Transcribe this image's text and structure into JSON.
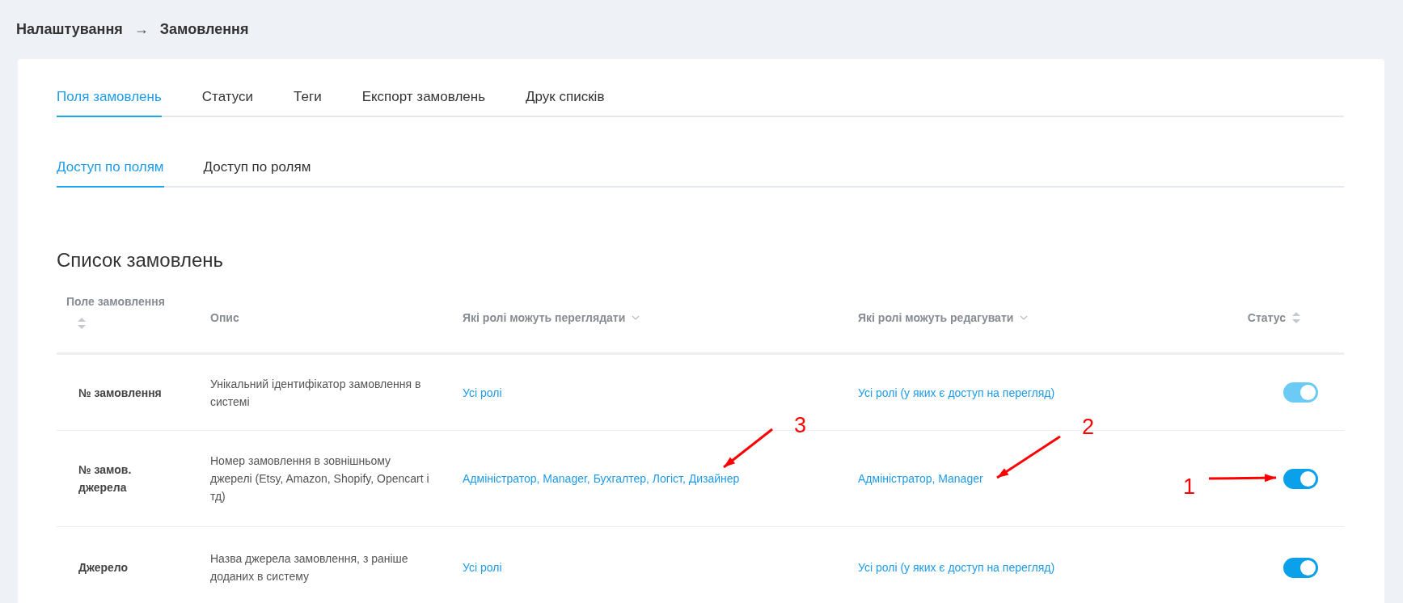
{
  "breadcrumb": {
    "parent": "Налаштування",
    "separator": "→",
    "current": "Замовлення"
  },
  "tabs": [
    {
      "label": "Поля замовлень",
      "selected": true
    },
    {
      "label": "Статуси",
      "selected": false
    },
    {
      "label": "Теги",
      "selected": false
    },
    {
      "label": "Експорт замовлень",
      "selected": false
    },
    {
      "label": "Друк списків",
      "selected": false
    }
  ],
  "subtabs": [
    {
      "label": "Доступ по полям",
      "selected": true
    },
    {
      "label": "Доступ по ролям",
      "selected": false
    }
  ],
  "section_title": "Список замовлень",
  "table": {
    "columns": [
      {
        "label": "Поле замовлення",
        "kind": "stacked-sort"
      },
      {
        "label": "Опис",
        "kind": "plain"
      },
      {
        "label": "Які ролі можуть переглядати",
        "kind": "filter"
      },
      {
        "label": "Які ролі можуть редагувати",
        "kind": "filter"
      },
      {
        "label": "Статус",
        "kind": "sort"
      }
    ],
    "rows": [
      {
        "field": "№ замовлення",
        "description": "Унікальний ідентифікатор замовлення в системі",
        "view_roles": "Усі ролі",
        "edit_roles": "Усі ролі (у яких є доступ на перегляд)",
        "on": true,
        "disabled": true
      },
      {
        "field": "№ замов. джерела",
        "description": "Номер замовлення в зовнішньому джерелі (Etsy, Amazon, Shopify, Opencart і тд)",
        "view_roles": "Адміністратор, Manager, Бухгалтер, Логіст, Дизайнер",
        "edit_roles": "Адміністратор, Manager",
        "on": true,
        "disabled": false
      },
      {
        "field": "Джерело",
        "description": "Назва джерела замовлення, з раніше доданих в систему",
        "view_roles": "Усі ролі",
        "edit_roles": "Усі ролі (у яких є доступ на перегляд)",
        "on": true,
        "disabled": false
      }
    ]
  },
  "annotations": [
    {
      "label": "3"
    },
    {
      "label": "2"
    },
    {
      "label": "1"
    }
  ]
}
